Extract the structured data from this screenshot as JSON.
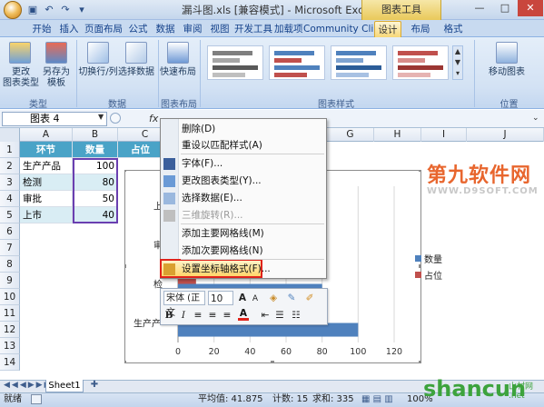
{
  "window": {
    "title": "漏斗图.xls [兼容模式] - Microsoft Excel",
    "chart_tools": "图表工具",
    "controls": [
      "—",
      "□",
      "✕"
    ]
  },
  "ribbon": {
    "tabs": [
      "开始",
      "插入",
      "页面布局",
      "公式",
      "数据",
      "审阅",
      "视图",
      "开发工具",
      "加载项",
      "Community Clips",
      "设计",
      "布局",
      "格式"
    ],
    "active_tab": "设计",
    "groups": {
      "type": {
        "label": "类型",
        "buttons": [
          "更改\n图表类型",
          "另存为\n模板"
        ]
      },
      "data": {
        "label": "数据",
        "buttons": [
          "切换行/列",
          "选择数据"
        ]
      },
      "layout": {
        "label": "图表布局",
        "buttons": [
          "快速布局"
        ]
      },
      "styles": {
        "label": "图表样式"
      },
      "location": {
        "label": "位置",
        "buttons": [
          "移动图表"
        ]
      }
    }
  },
  "formula_bar": {
    "name_box": "图表 4",
    "fx": "fx"
  },
  "grid": {
    "columns": [
      "A",
      "B",
      "C",
      "D",
      "E",
      "F",
      "G",
      "H",
      "I",
      "J"
    ],
    "rows": [
      "1",
      "2",
      "3",
      "4",
      "5",
      "6",
      "7",
      "8",
      "9",
      "10",
      "11",
      "12",
      "13",
      "14"
    ],
    "header_row": [
      "环节",
      "数量",
      "占位"
    ],
    "data_rows": [
      {
        "stage": "生产产品",
        "qty": "100"
      },
      {
        "stage": "检测",
        "qty": "80"
      },
      {
        "stage": "审批",
        "qty": "50"
      },
      {
        "stage": "上市",
        "qty": "40"
      }
    ]
  },
  "chart_data": {
    "type": "bar",
    "categories": [
      "生产产品",
      "检测",
      "审批",
      "上市"
    ],
    "series": [
      {
        "name": "数量",
        "values": [
          100,
          80,
          50,
          40
        ],
        "color": "#4f81bd"
      },
      {
        "name": "占位",
        "values": [
          0,
          10,
          25,
          30
        ],
        "color": "#c0504d"
      }
    ],
    "xticks": [
      "0",
      "20",
      "40",
      "60",
      "80",
      "100",
      "120"
    ],
    "xlim": [
      0,
      120
    ],
    "legend": "right",
    "visible_category_labels": [
      "上",
      "审",
      "检",
      "生产产"
    ]
  },
  "context_menu": {
    "items": [
      {
        "label": "删除(D)",
        "disabled": false
      },
      {
        "label": "重设以匹配样式(A)",
        "disabled": false
      },
      {
        "label": "字体(F)...",
        "disabled": false
      },
      {
        "label": "更改图表类型(Y)...",
        "disabled": false
      },
      {
        "label": "选择数据(E)...",
        "disabled": false
      },
      {
        "label": "三维旋转(R)...",
        "disabled": true
      },
      {
        "label": "添加主要网格线(M)",
        "disabled": false
      },
      {
        "label": "添加次要网格线(N)",
        "disabled": false
      },
      {
        "label": "设置坐标轴格式(F)...",
        "disabled": false
      }
    ],
    "highlighted": "设置坐标轴格式(F)..."
  },
  "mini_toolbar": {
    "font_name": "宋体 (正文",
    "font_size": "10",
    "grow": "A",
    "shrink": "A",
    "bold": "B",
    "italic": "I",
    "font_color": "A"
  },
  "sheet_tab": "Sheet1",
  "status": {
    "ready": "就绪",
    "average": "平均值: 41.875",
    "count": "计数: 15",
    "sum": "求和: 335",
    "zoom": "100%"
  },
  "watermarks": {
    "top": "第九软件网",
    "top_sub": "WWW.D9SOFT.COM",
    "bottom": "shancun",
    "bottom_sub": "山村网 .net"
  },
  "colors": {
    "accent_header": "#4aa3c7",
    "series1": "#4f81bd",
    "series2": "#c0504d",
    "highlight_border": "#e0231b"
  }
}
